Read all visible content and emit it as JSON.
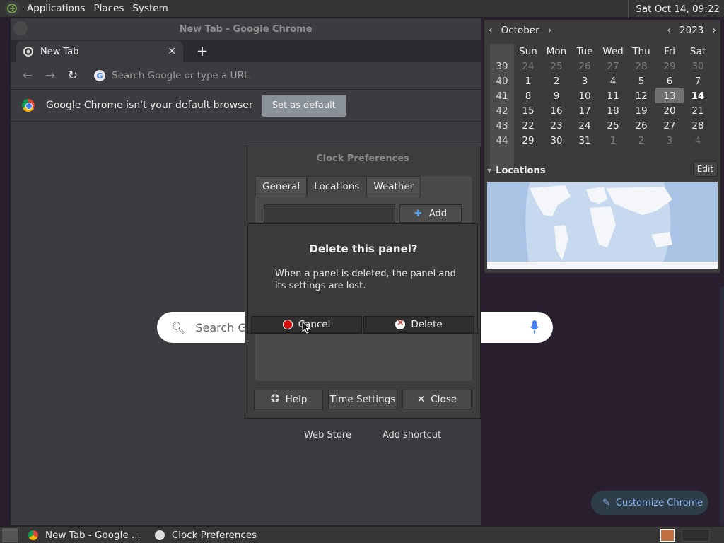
{
  "top_panel": {
    "menus": [
      "Applications",
      "Places",
      "System"
    ],
    "clock": "Sat Oct 14, 09:22"
  },
  "chrome": {
    "window_title": "New Tab - Google Chrome",
    "tab_title": "New Tab",
    "omnibox_placeholder": "Search Google or type a URL",
    "infobar_message": "Google Chrome isn't your default browser",
    "infobar_button": "Set as default",
    "ntp_search_placeholder": "Search G",
    "links": [
      "Web Store",
      "Add shortcut"
    ],
    "customize": "Customize Chrome"
  },
  "calendar": {
    "month": "October",
    "year": "2023",
    "weekdays": [
      "Sun",
      "Mon",
      "Tue",
      "Wed",
      "Thu",
      "Fri",
      "Sat"
    ],
    "weeks": [
      {
        "wk": "39",
        "days": [
          "24",
          "25",
          "26",
          "27",
          "28",
          "29",
          "30"
        ]
      },
      {
        "wk": "40",
        "days": [
          "1",
          "2",
          "3",
          "4",
          "5",
          "6",
          "7"
        ]
      },
      {
        "wk": "41",
        "days": [
          "8",
          "9",
          "10",
          "11",
          "12",
          "13",
          "14"
        ]
      },
      {
        "wk": "42",
        "days": [
          "15",
          "16",
          "17",
          "18",
          "19",
          "20",
          "21"
        ]
      },
      {
        "wk": "43",
        "days": [
          "22",
          "23",
          "24",
          "25",
          "26",
          "27",
          "28"
        ]
      },
      {
        "wk": "44",
        "days": [
          "29",
          "30",
          "31",
          "1",
          "2",
          "3",
          "4"
        ]
      }
    ],
    "locations_label": "Locations",
    "edit_label": "Edit"
  },
  "clock_prefs": {
    "title": "Clock Preferences",
    "tabs": [
      "General",
      "Locations",
      "Weather"
    ],
    "add_label": "Add",
    "help_label": "Help",
    "time_settings_label": "Time Settings",
    "close_label": "Close"
  },
  "delete_dialog": {
    "heading": "Delete this panel?",
    "message": "When a panel is deleted, the panel and its settings are lost.",
    "cancel_label": "Cancel",
    "delete_label": "Delete"
  },
  "taskbar": {
    "tasks": [
      "New Tab - Google ...",
      "Clock Preferences"
    ]
  }
}
